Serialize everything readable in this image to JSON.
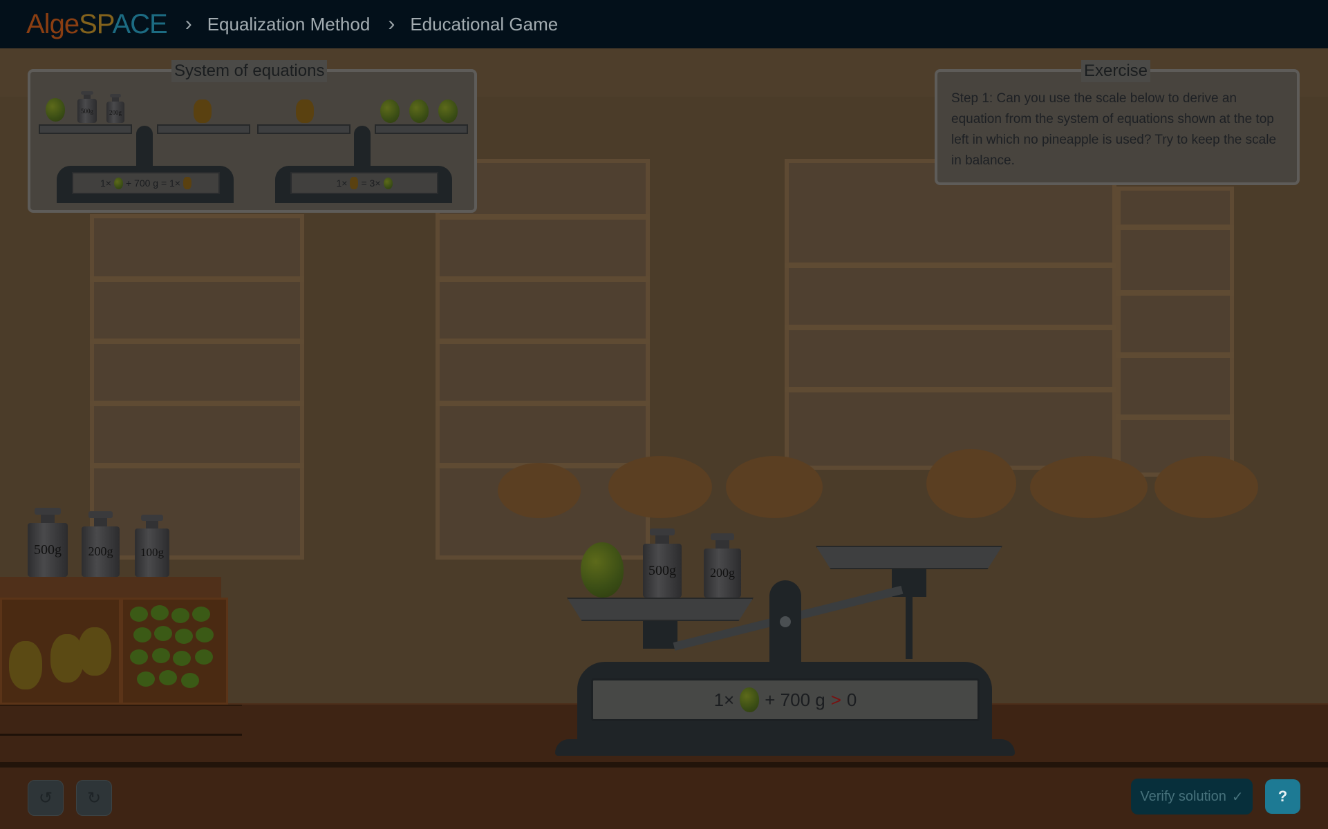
{
  "header": {
    "logo": {
      "part1": "Alge",
      "part2": "SP",
      "part3": "ACE"
    },
    "breadcrumb": [
      "Equalization Method",
      "Educational Game"
    ]
  },
  "system_panel": {
    "title": "System of equations",
    "equation1": {
      "lhs_count": "1×",
      "plus": "+ 700 g = 1×",
      "left_weights": [
        "500g",
        "200g"
      ]
    },
    "equation2": {
      "lhs": "1×",
      "mid": "= 3×"
    }
  },
  "exercise_panel": {
    "title": "Exercise",
    "text": "Step 1: Can you use the scale below to derive an equation from the system of equations shown at the top left in which no pineapple is used? Try to keep the scale in balance."
  },
  "shelf_weights": [
    "500g",
    "200g",
    "100g"
  ],
  "main_scale": {
    "left_weights": [
      "500g",
      "200g"
    ],
    "display": {
      "count": "1×",
      "rest": "+ 700 g",
      "relation": ">",
      "rhs": "0"
    }
  },
  "controls": {
    "undo_icon": "undo-icon",
    "redo_icon": "redo-icon",
    "verify_label": "Verify solution",
    "help_label": "?"
  },
  "colors": {
    "overlay_tint": "#000000",
    "help_button": "#1d7a94",
    "verify_button": "#072f3b"
  }
}
